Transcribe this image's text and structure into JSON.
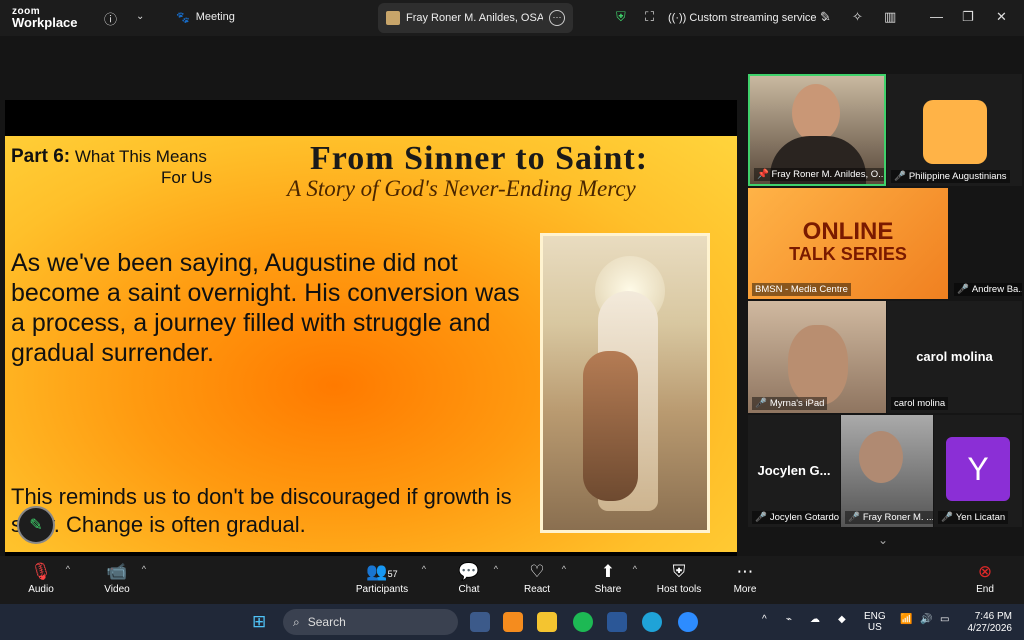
{
  "app": {
    "logo_top": "zoom",
    "logo_bottom": "Workplace"
  },
  "titlebar": {
    "meeting_label": "Meeting",
    "share_tab": "Fray Roner M. Anildes, OSA's scre",
    "streaming": "Custom streaming service"
  },
  "slide": {
    "part_bold": "Part 6:",
    "part_text": "What This Means",
    "part_text2": "For Us",
    "title": "From Sinner to Saint:",
    "subtitle": "A Story of God's Never-Ending Mercy",
    "para1": "As we've been saying, Augustine did not become a saint overnight. His conversion was a process, a journey filled with struggle and gradual surrender.",
    "para2": "This reminds us to don't be discouraged if growth is slow. Change is often gradual."
  },
  "participants": [
    {
      "name": "Fray Roner M. Anildes, O..."
    },
    {
      "name": "Philippine Augustinians"
    },
    {
      "name": "BMSN - Media Centre",
      "banner1": "ONLINE",
      "banner2": "TALK SERIES"
    },
    {
      "name": "Andrew Ba..."
    },
    {
      "name": "Myrna's iPad"
    },
    {
      "name": "carol molina",
      "display": "carol molina"
    },
    {
      "name": "Jocylen Gotardo",
      "display": "Jocylen G..."
    },
    {
      "name": "Fray Roner M. ..."
    },
    {
      "name": "Yen Licatan",
      "initial": "Y"
    }
  ],
  "toolbar": {
    "audio": "Audio",
    "video": "Video",
    "participants": "Participants",
    "participants_count": "57",
    "chat": "Chat",
    "react": "React",
    "share": "Share",
    "host_tools": "Host tools",
    "more": "More",
    "end": "End"
  },
  "taskbar": {
    "search": "Search",
    "lang": "ENG",
    "region": "US",
    "time": "7:46 PM",
    "date": "4/27/2026"
  },
  "colors": {
    "accent_green": "#3fd16b",
    "end_red": "#e02828",
    "yen_purple": "#8b2fd6"
  }
}
